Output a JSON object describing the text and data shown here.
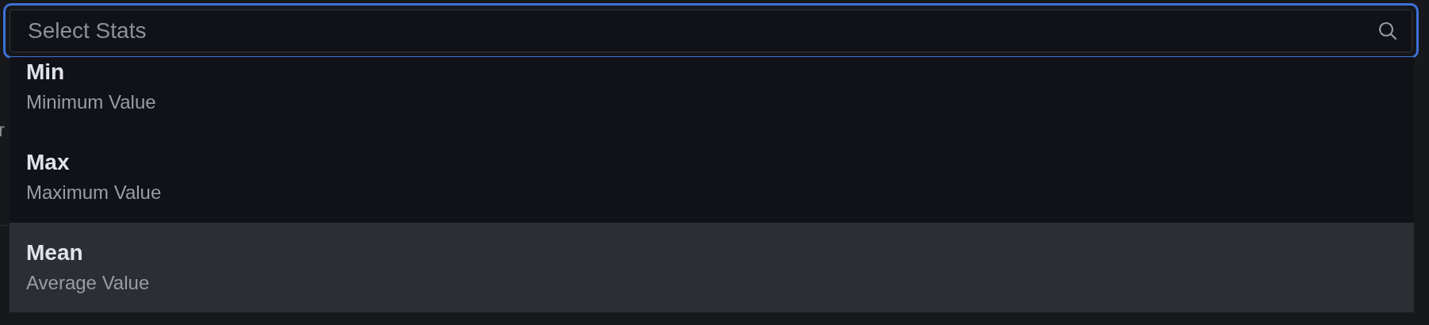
{
  "background": {
    "text": "r"
  },
  "select": {
    "placeholder": "Select Stats"
  },
  "options": [
    {
      "label": "Min",
      "description": "Minimum Value",
      "selected": false
    },
    {
      "label": "Max",
      "description": "Maximum Value",
      "selected": false
    },
    {
      "label": "Mean",
      "description": "Average Value",
      "selected": true
    }
  ]
}
